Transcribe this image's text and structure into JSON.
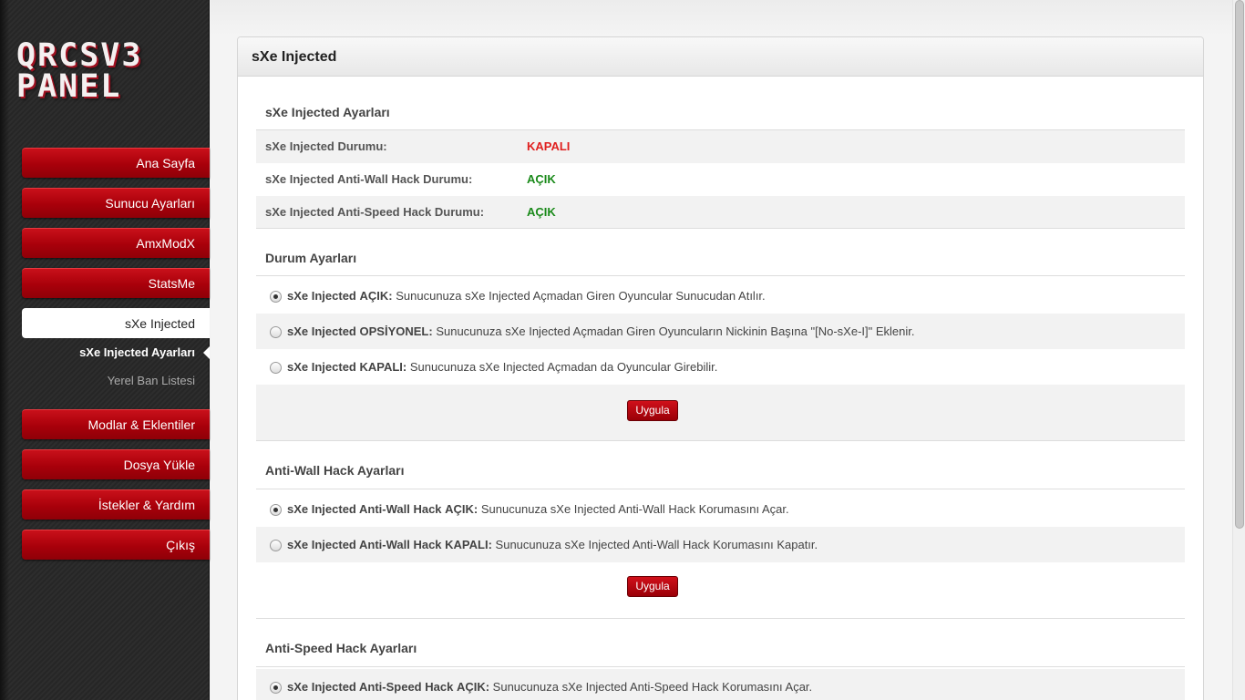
{
  "logo": {
    "line1": "QRCSV3",
    "line2": "PANEL"
  },
  "nav": {
    "items": [
      {
        "label": "Ana Sayfa"
      },
      {
        "label": "Sunucu Ayarları"
      },
      {
        "label": "AmxModX"
      },
      {
        "label": "StatsMe"
      },
      {
        "label": "sXe Injected"
      },
      {
        "label": "Modlar & Eklentiler"
      },
      {
        "label": "Dosya Yükle"
      },
      {
        "label": "İstekler & Yardım"
      },
      {
        "label": "Çıkış"
      }
    ],
    "sub_items": [
      {
        "label": "sXe Injected Ayarları"
      },
      {
        "label": "Yerel Ban Listesi"
      }
    ]
  },
  "panel": {
    "title": "sXe Injected",
    "settings": {
      "title": "sXe Injected Ayarları",
      "rows": [
        {
          "label": "sXe Injected Durumu:",
          "value": "KAPALI"
        },
        {
          "label": "sXe Injected Anti-Wall Hack Durumu:",
          "value": "AÇIK"
        },
        {
          "label": "sXe Injected Anti-Speed Hack Durumu:",
          "value": "AÇIK"
        }
      ]
    },
    "durum": {
      "title": "Durum Ayarları",
      "options": [
        {
          "prefix": "sXe Injected",
          "state": "AÇIK:",
          "desc": "Sunucunuza sXe Injected Açmadan Giren Oyuncular Sunucudan Atılır."
        },
        {
          "prefix": "sXe Injected",
          "state": "OPSİYONEL:",
          "desc": "Sunucunuza sXe Injected Açmadan Giren Oyuncuların Nickinin Başına \"[No-sXe-I]\" Eklenir."
        },
        {
          "prefix": "sXe Injected",
          "state": "KAPALI:",
          "desc": "Sunucunuza sXe Injected Açmadan da Oyuncular Girebilir."
        }
      ],
      "button": "Uygula"
    },
    "antiwall": {
      "title": "Anti-Wall Hack Ayarları",
      "options": [
        {
          "prefix": "sXe Injected Anti-Wall Hack",
          "state": "AÇIK:",
          "desc": "Sunucunuza sXe Injected Anti-Wall Hack Korumasını Açar."
        },
        {
          "prefix": "sXe Injected Anti-Wall Hack",
          "state": "KAPALI:",
          "desc": "Sunucunuza sXe Injected Anti-Wall Hack Korumasını Kapatır."
        }
      ],
      "button": "Uygula"
    },
    "antispeed": {
      "title": "Anti-Speed Hack Ayarları",
      "options": [
        {
          "prefix": "sXe Injected Anti-Speed Hack",
          "state": "AÇIK:",
          "desc": "Sunucunuza sXe Injected Anti-Speed Hack Korumasını Açar."
        }
      ]
    }
  },
  "colors": {
    "accent": "#b0000c",
    "on": "#1a8a1a",
    "off": "#e0201f",
    "optional": "#f08a1d"
  }
}
